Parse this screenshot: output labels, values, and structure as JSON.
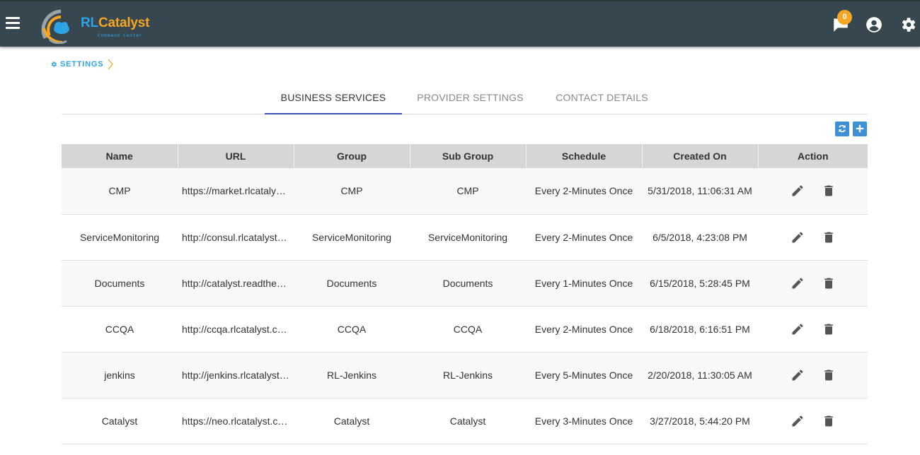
{
  "header": {
    "logo_text_rl": "RL",
    "logo_text_rest": "Catalyst",
    "logo_subtitle": "Command Center",
    "notification_count": "0",
    "icons": [
      "menu-icon",
      "chat-icon",
      "account-icon",
      "gear-icon"
    ],
    "bar_color": "#37474f"
  },
  "breadcrumb": {
    "label": "SETTINGS"
  },
  "tabs": [
    {
      "label": "BUSINESS SERVICES",
      "active": true
    },
    {
      "label": "PROVIDER SETTINGS",
      "active": false
    },
    {
      "label": "CONTACT DETAILS",
      "active": false
    }
  ],
  "toolbar": {
    "icons": [
      "refresh-icon",
      "add-icon"
    ]
  },
  "table": {
    "headers": [
      "Name",
      "URL",
      "Group",
      "Sub Group",
      "Schedule",
      "Created On",
      "Action"
    ],
    "rows": [
      {
        "name": "CMP",
        "url": "https://market.rlcatalyst…",
        "group": "CMP",
        "subgroup": "CMP",
        "schedule": "Every 2-Minutes Once",
        "created": "5/31/2018, 11:06:31 AM"
      },
      {
        "name": "ServiceMonitoring",
        "url": "http://consul.rlcatalyst.…",
        "group": "ServiceMonitoring",
        "subgroup": "ServiceMonitoring",
        "schedule": "Every 2-Minutes Once",
        "created": "6/5/2018, 4:23:08 PM"
      },
      {
        "name": "Documents",
        "url": "http://catalyst.readthed…",
        "group": "Documents",
        "subgroup": "Documents",
        "schedule": "Every 1-Minutes Once",
        "created": "6/15/2018, 5:28:45 PM"
      },
      {
        "name": "CCQA",
        "url": "http://ccqa.rlcatalyst.com/",
        "group": "CCQA",
        "subgroup": "CCQA",
        "schedule": "Every 2-Minutes Once",
        "created": "6/18/2018, 6:16:51 PM"
      },
      {
        "name": "jenkins",
        "url": "http://jenkins.rlcatalyst.…",
        "group": "RL-Jenkins",
        "subgroup": "RL-Jenkins",
        "schedule": "Every 5-Minutes Once",
        "created": "2/20/2018, 11:30:05 AM"
      },
      {
        "name": "Catalyst",
        "url": "https://neo.rlcatalyst.com/",
        "group": "Catalyst",
        "subgroup": "Catalyst",
        "schedule": "Every 3-Minutes Once",
        "created": "3/27/2018, 5:44:20 PM"
      }
    ],
    "action_icons": [
      "edit-icon",
      "delete-icon"
    ]
  },
  "colors": {
    "accent_blue": "#2ea3e6",
    "accent_orange": "#f5a623",
    "tab_indicator": "#3f51b5",
    "button_blue": "#3d8fd6"
  }
}
